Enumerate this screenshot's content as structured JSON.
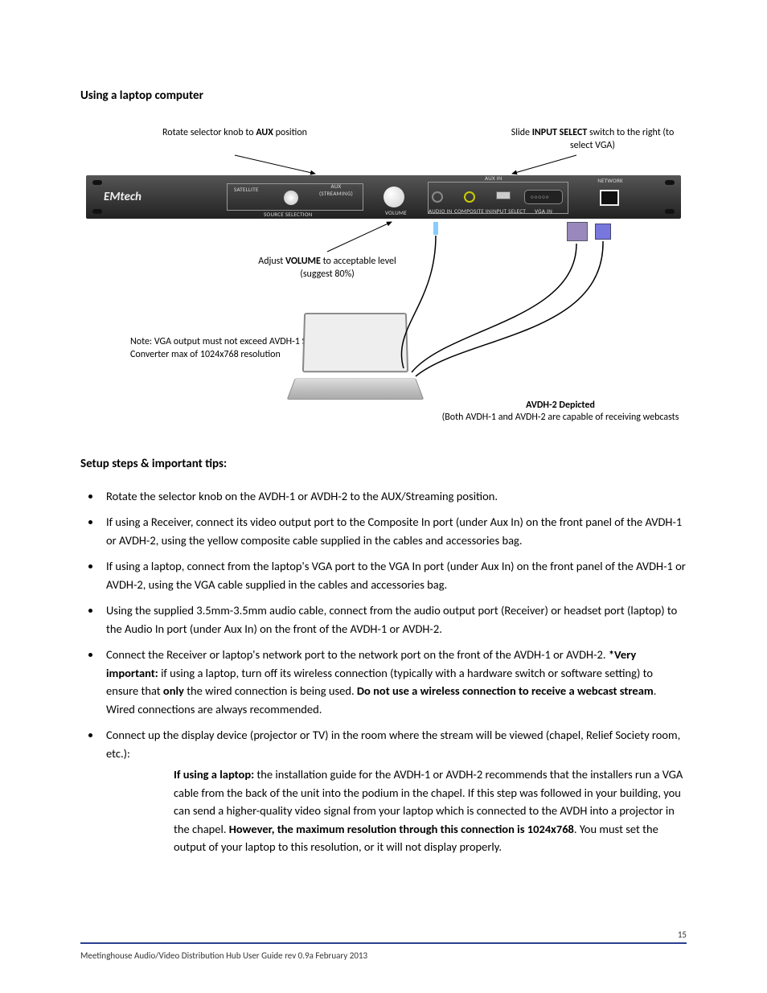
{
  "title": "Using a laptop computer",
  "diagram": {
    "callout_aux_pre": "Rotate selector knob to ",
    "callout_aux_bold": "AUX",
    "callout_aux_post": " position",
    "callout_input_pre": "Slide ",
    "callout_input_bold": "INPUT SELECT",
    "callout_input_post": " switch to the right (to select VGA)",
    "callout_vol_pre": "Adjust ",
    "callout_vol_bold": "VOLUME",
    "callout_vol_post": " to acceptable level (suggest 80%)",
    "note": "Note:  VGA output must not exceed AVDH-1 Scan Converter max of 1024x768 resolution",
    "depicted_title": "AVDH-2 Depicted",
    "depicted_sub": "(Both AVDH-1 and AVDH-2 are capable of receiving webcasts",
    "brand": "EMtech",
    "panel_labels": {
      "satellite": "SATELLITE",
      "aux_stream": "AUX (STREAMING)",
      "source_sel": "SOURCE SELECTION",
      "volume": "VOLUME",
      "audio_in": "AUDIO IN",
      "composite_in": "COMPOSITE IN",
      "input_select": "INPUT SELECT",
      "vga_in": "VGA IN",
      "aux_in": "AUX IN",
      "network": "NETWORK"
    }
  },
  "steps_title": "Setup steps & important tips:",
  "steps": [
    "Rotate the selector knob on the AVDH-1 or AVDH-2 to the AUX/Streaming position.",
    "If using a Receiver, connect its video output port to the Composite In port (under Aux In) on the front panel of the AVDH-1 or AVDH-2, using the yellow composite cable supplied in the cables and accessories bag.",
    "If using a laptop, connect from the laptop's VGA port to the VGA In port (under Aux In) on the front panel of the AVDH-1 or AVDH-2, using the VGA cable supplied in the cables and accessories bag.",
    "Using the supplied 3.5mm-3.5mm audio cable, connect from the audio output port (Receiver) or headset port (laptop) to the Audio In port (under Aux In) on the front of the AVDH-1 or AVDH-2."
  ],
  "step5": {
    "pre": "Connect the Receiver or laptop's network port to the network port on the front of the AVDH-1 or AVDH-2. ",
    "b1": "*Very important:",
    "mid1": " if using a laptop, turn off its wireless connection (typically with a hardware switch or software setting) to ensure that ",
    "b2": "only",
    "mid2": " the wired connection is being used. ",
    "b3": "Do not use a wireless connection to receive a webcast stream",
    "post": ". Wired connections are always recommended."
  },
  "step6": "Connect up the display device (projector or TV) in the room where the stream will be viewed (chapel, Relief Society room, etc.):",
  "sub6": {
    "b1": "If using a laptop:",
    "t1": " the installation guide for the AVDH-1 or AVDH-2 recommends that the installers run a VGA cable from the back of the unit into the podium in the chapel. If this step was followed in your building, you can send a higher-quality video signal from your laptop which is connected to the AVDH into a projector in the chapel. ",
    "b2": "However, the maximum resolution through this connection is 1024x768",
    "t2": ". You must set the output of your laptop to this resolution, or it will not display properly."
  },
  "footer": "Meetinghouse Audio/Video Distribution Hub User Guide rev 0.9a February 2013",
  "page_number": "15"
}
